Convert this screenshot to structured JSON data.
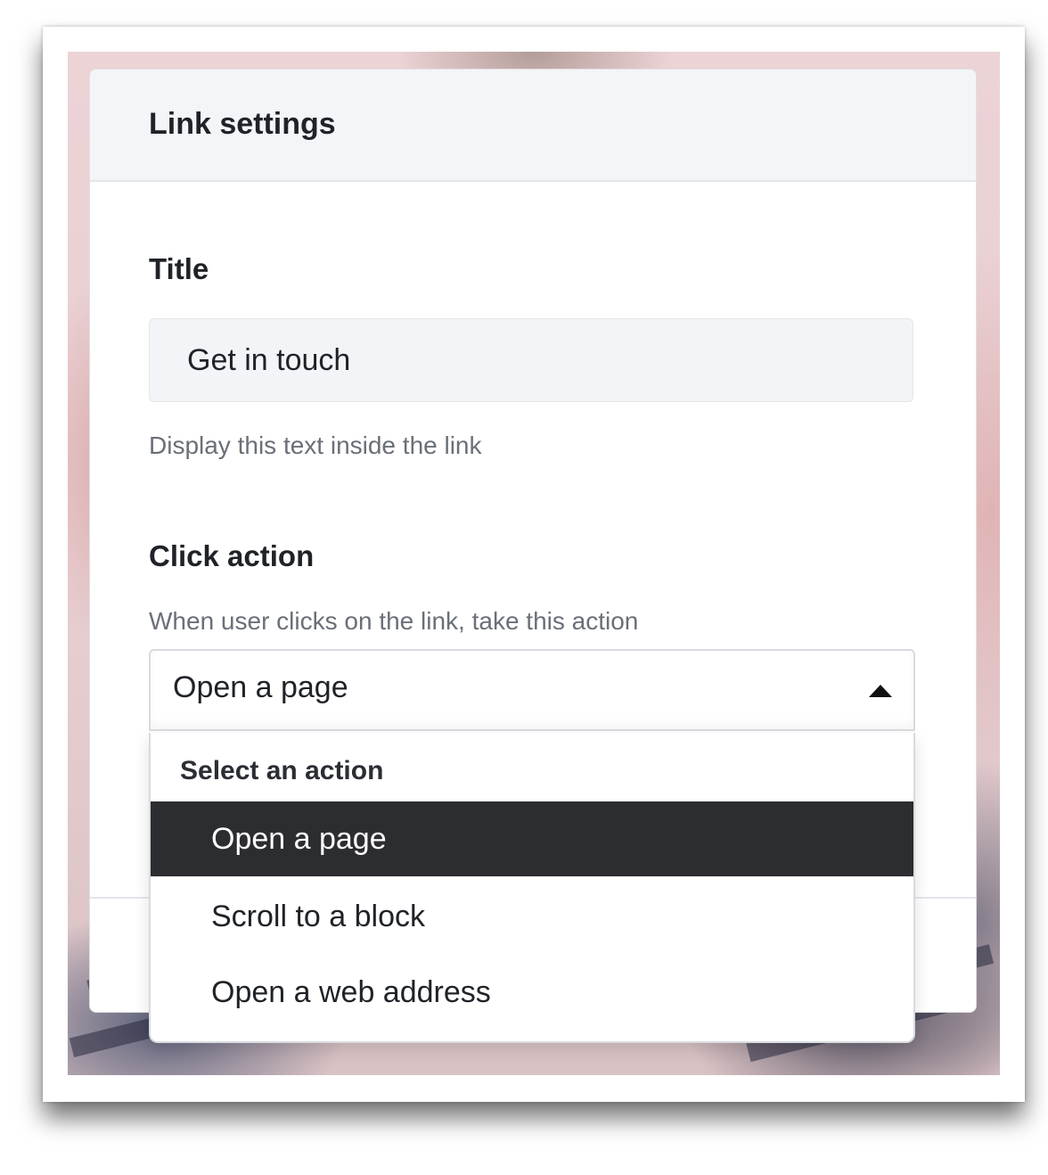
{
  "dialog": {
    "title": "Link settings"
  },
  "title_field": {
    "label": "Title",
    "value": "Get in touch",
    "hint": "Display this text inside the link"
  },
  "click_action": {
    "label": "Click action",
    "hint": "When user clicks on the link, take this action",
    "selected": "Open a page",
    "caret_icon": "triangle-up-icon",
    "dropdown": {
      "group_label": "Select an action",
      "options": [
        {
          "label": "Open a page",
          "selected": true
        },
        {
          "label": "Scroll to a block",
          "selected": false
        },
        {
          "label": "Open a web address",
          "selected": false
        }
      ]
    }
  },
  "colors": {
    "selected_option_bg": "#2c2d30",
    "header_bg": "#f4f5f8",
    "input_bg": "#f3f4f7"
  }
}
